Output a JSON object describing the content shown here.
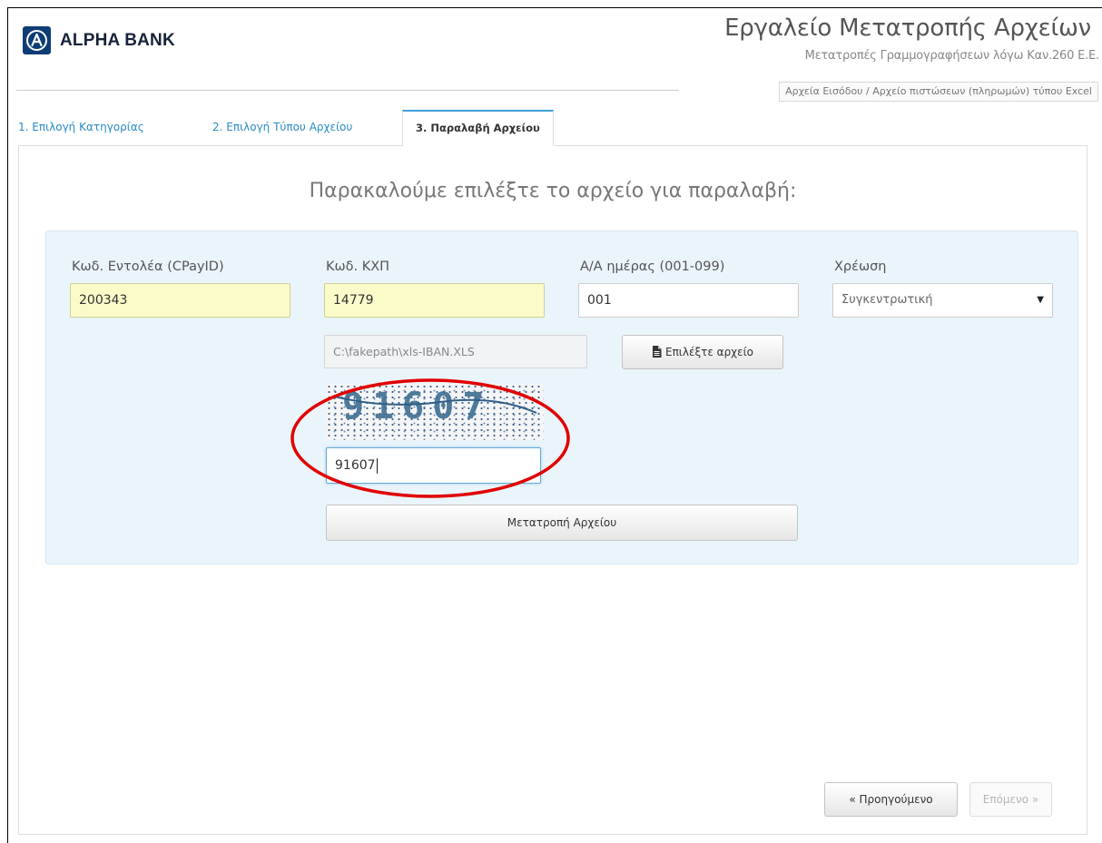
{
  "header": {
    "brand": "ALPHA BANK",
    "app_title": "Εργαλείο Μετατροπής Αρχείων",
    "app_subtitle": "Μετατροπές Γραμμογραφήσεων λόγω Καν.260 Ε.Ε.",
    "breadcrumb": "Αρχεία Εισόδου / Αρχείο πιστώσεων (πληρωμών) τύπου Excel"
  },
  "tabs": [
    {
      "label": "1. Επιλογή Κατηγορίας",
      "active": false
    },
    {
      "label": "2. Επιλογή Τύπου Αρχείου",
      "active": false
    },
    {
      "label": "3. Παραλαβή Αρχείου",
      "active": true
    }
  ],
  "main": {
    "prompt": "Παρακαλούμε επιλέξτε το αρχείο για παραλαβή:",
    "fields": {
      "cpayid": {
        "label": "Κωδ. Εντολέα (CPayID)",
        "value": "200343"
      },
      "kxp": {
        "label": "Κωδ. ΚΧΠ",
        "value": "14779"
      },
      "day_seq": {
        "label": "Α/Α ημέρας (001-099)",
        "value": "001"
      },
      "charge": {
        "label": "Χρέωση",
        "value": "Συγκεντρωτική"
      }
    },
    "file": {
      "path": "C:\\fakepath\\xls-IBAN.XLS",
      "choose_label": "Επιλέξτε αρχείο"
    },
    "captcha": {
      "image_text": "91607",
      "input_value": "91607"
    },
    "convert_label": "Μετατροπή Αρχείου"
  },
  "footer": {
    "previous_label": "« Προηγούμενο",
    "next_label": "Επόμενο »"
  },
  "colors": {
    "brand": "#0d3d74",
    "tab_link": "#2a8bc7",
    "active_tab_border": "#3fa0d9",
    "highlight_field": "#fafbc8",
    "well_background": "#eaf4fb",
    "annotation": "#e00000"
  },
  "icons": {
    "logo": "alpha-bank-logo-icon",
    "file": "document-icon",
    "select": "caret-down-icon"
  }
}
